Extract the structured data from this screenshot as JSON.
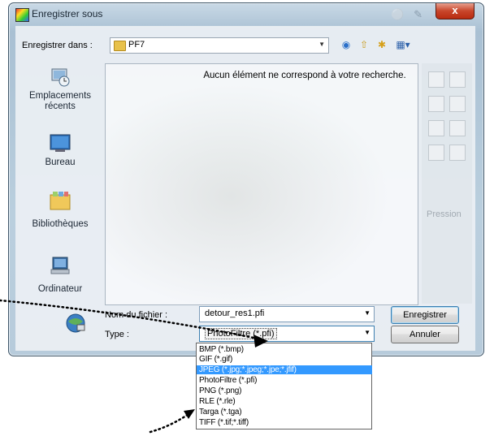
{
  "dialog": {
    "title": "Enregistrer sous",
    "close_label": "x"
  },
  "save_in": {
    "label": "Enregistrer dans :",
    "value": "PF7"
  },
  "file_list": {
    "empty_message": "Aucun élément ne correspond à votre recherche."
  },
  "places": [
    {
      "icon": "recent-places-icon",
      "label_line1": "Emplacements",
      "label_line2": "récents"
    },
    {
      "icon": "desktop-icon",
      "label_line1": "Bureau",
      "label_line2": ""
    },
    {
      "icon": "libraries-icon",
      "label_line1": "Bibliothèques",
      "label_line2": ""
    },
    {
      "icon": "computer-icon",
      "label_line1": "Ordinateur",
      "label_line2": ""
    },
    {
      "icon": "network-icon",
      "label_line1": "",
      "label_line2": ""
    }
  ],
  "filename": {
    "label": "Nom du fichier :",
    "value": "detour_res1.pfi"
  },
  "type": {
    "label": "Type :",
    "value": "PhotoFiltre (*.pfi)",
    "options": [
      "BMP (*.bmp)",
      "GIF (*.gif)",
      "JPEG (*.jpg;*.jpeg;*.jpe;*.jfif)",
      "PhotoFiltre (*.pfi)",
      "PNG (*.png)",
      "RLE (*.rle)",
      "Targa (*.tga)",
      "TIFF (*.tif;*.tiff)"
    ],
    "highlighted_index": 2
  },
  "buttons": {
    "save": "Enregistrer",
    "cancel": "Annuler"
  },
  "ghost": {
    "label": "Pression"
  },
  "colors": {
    "highlight": "#3399ff",
    "close_button": "#c8462b"
  }
}
